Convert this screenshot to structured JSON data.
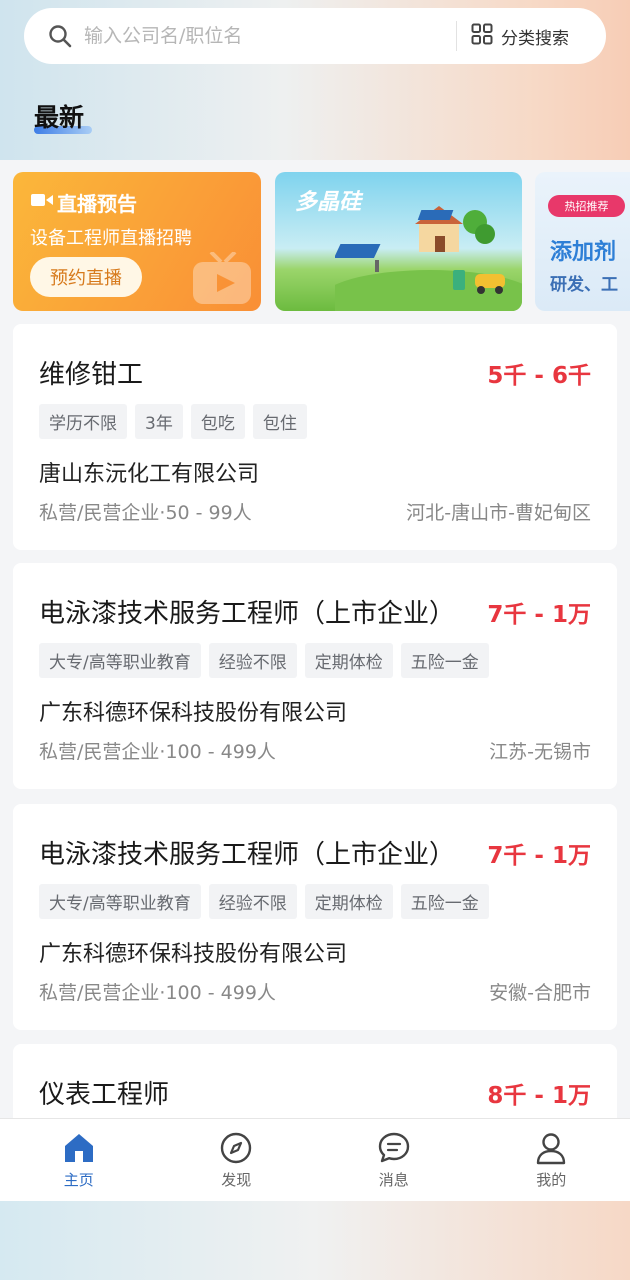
{
  "search": {
    "placeholder": "输入公司名/职位名",
    "category_label": "分类搜索"
  },
  "section": {
    "title": "最新"
  },
  "banners": {
    "live": {
      "title": "直播预告",
      "subtitle": "设备工程师直播招聘",
      "button": "预约直播"
    },
    "solar": {
      "brand": "多晶硅"
    },
    "hot": {
      "badge": "热招推荐",
      "headline": "添加剂",
      "sub": "研发、工"
    }
  },
  "jobs": [
    {
      "title": "维修钳工",
      "salary": "5千 - 6千",
      "tags": [
        "学历不限",
        "3年",
        "包吃",
        "包住"
      ],
      "company": "唐山东沅化工有限公司",
      "meta": "私营/民营企业·50 - 99人",
      "location": "河北-唐山市-曹妃甸区"
    },
    {
      "title": "电泳漆技术服务工程师（上市企业）",
      "salary": "7千 - 1万",
      "tags": [
        "大专/高等职业教育",
        "经验不限",
        "定期体检",
        "五险一金"
      ],
      "company": "广东科德环保科技股份有限公司",
      "meta": "私营/民营企业·100 - 499人",
      "location": "江苏-无锡市"
    },
    {
      "title": "电泳漆技术服务工程师（上市企业）",
      "salary": "7千 - 1万",
      "tags": [
        "大专/高等职业教育",
        "经验不限",
        "定期体检",
        "五险一金"
      ],
      "company": "广东科德环保科技股份有限公司",
      "meta": "私营/民营企业·100 - 499人",
      "location": "安徽-合肥市"
    },
    {
      "title": "仪表工程师",
      "salary": "8千 - 1万"
    }
  ],
  "tabbar": {
    "items": [
      {
        "label": "主页",
        "icon": "home-icon",
        "active": true
      },
      {
        "label": "发现",
        "icon": "compass-icon"
      },
      {
        "label": "消息",
        "icon": "message-icon"
      },
      {
        "label": "我的",
        "icon": "user-icon"
      }
    ],
    "active_color": "#2d6cc4"
  },
  "colors": {
    "salary": "#e8363f",
    "accent": "#2d6cc4"
  }
}
